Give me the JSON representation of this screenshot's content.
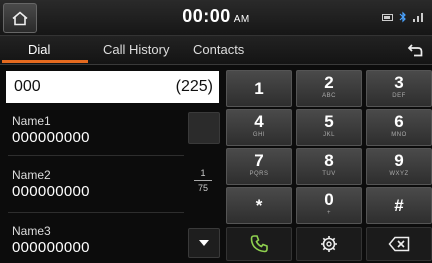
{
  "status": {
    "time": "00:00",
    "ampm": "AM"
  },
  "tabs": [
    {
      "label": "Dial",
      "active": true
    },
    {
      "label": "Call History",
      "active": false
    },
    {
      "label": "Contacts",
      "active": false
    }
  ],
  "dial": {
    "number": "000",
    "count": "(225)"
  },
  "contacts": [
    {
      "name": "Name1",
      "number": "000000000"
    },
    {
      "name": "Name2",
      "number": "000000000"
    },
    {
      "name": "Name3",
      "number": "000000000"
    }
  ],
  "pagination": {
    "current": "1",
    "total": "75"
  },
  "keypad": [
    {
      "digit": "1",
      "letters": ""
    },
    {
      "digit": "2",
      "letters": "ABC"
    },
    {
      "digit": "3",
      "letters": "DEF"
    },
    {
      "digit": "4",
      "letters": "GHI"
    },
    {
      "digit": "5",
      "letters": "JKL"
    },
    {
      "digit": "6",
      "letters": "MNO"
    },
    {
      "digit": "7",
      "letters": "PQRS"
    },
    {
      "digit": "8",
      "letters": "TUV"
    },
    {
      "digit": "9",
      "letters": "WXYZ"
    },
    {
      "digit": "*",
      "letters": ""
    },
    {
      "digit": "0",
      "letters": "+"
    },
    {
      "digit": "#",
      "letters": ""
    }
  ],
  "icons": {
    "home": "home-icon",
    "back": "back-icon",
    "call": "call-icon",
    "settings": "gear-icon",
    "delete": "backspace-icon",
    "scroll_down": "chevron-down-icon"
  },
  "colors": {
    "accent": "#e56a1f",
    "call": "#8fd14f"
  }
}
